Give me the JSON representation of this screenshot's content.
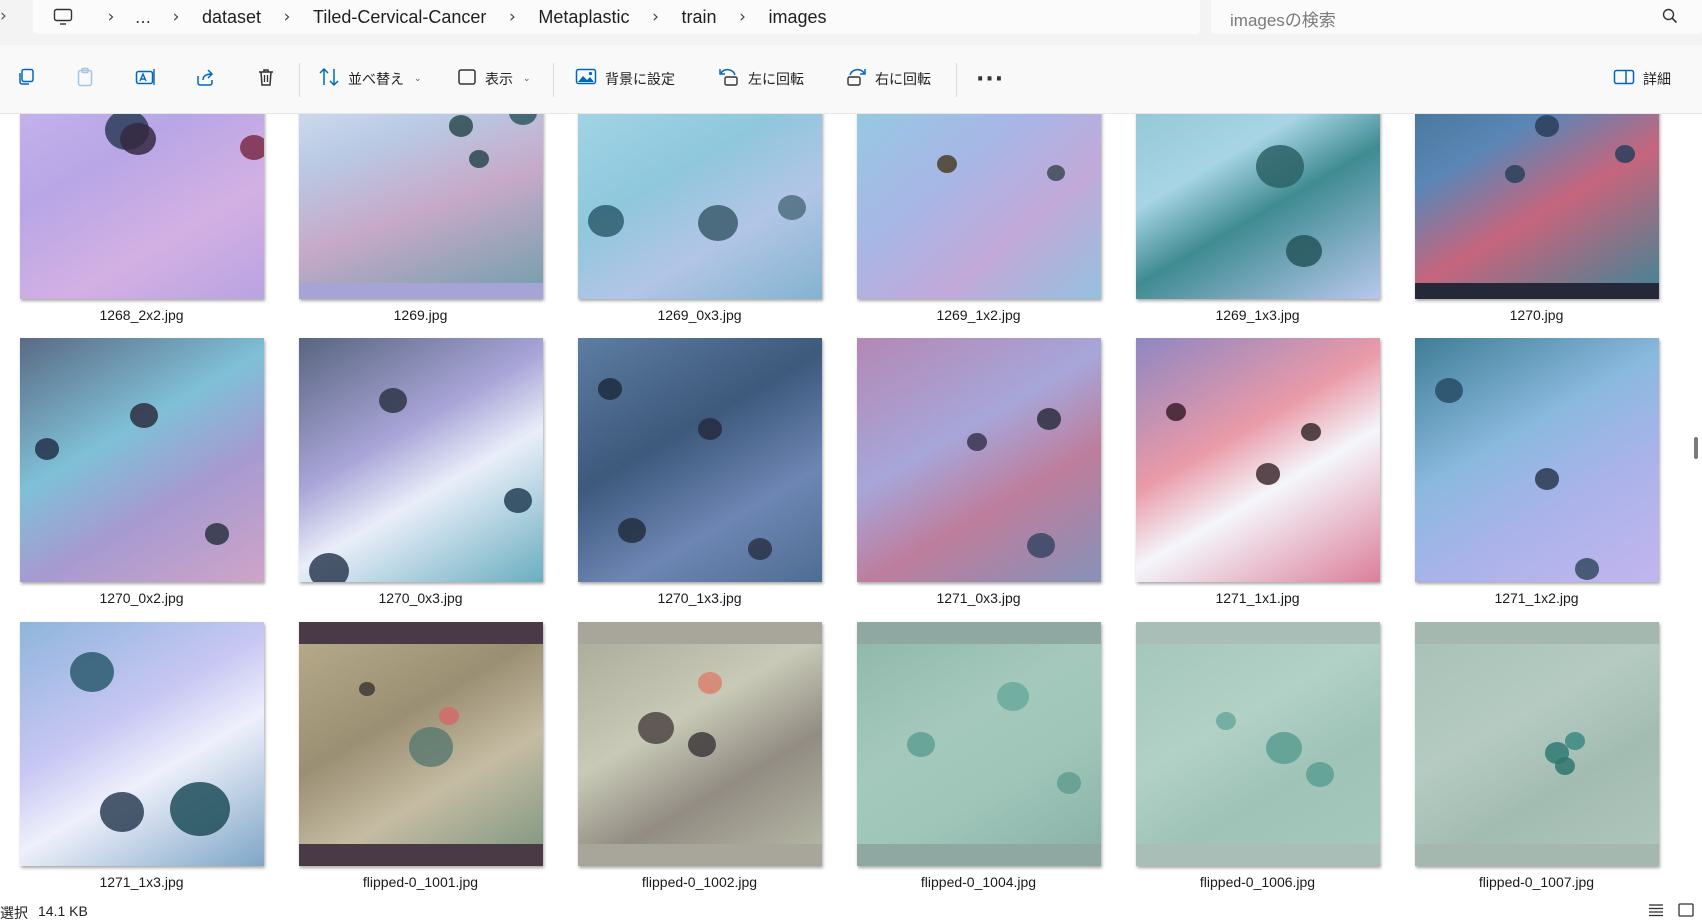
{
  "breadcrumb": {
    "more": "…",
    "items": [
      "dataset",
      "Tiled-Cervical-Cancer",
      "Metaplastic",
      "train",
      "images"
    ]
  },
  "search": {
    "placeholder": "imagesの検索"
  },
  "toolbar": {
    "sort_label": "並べ替え",
    "view_label": "表示",
    "set_background_label": "背景に設定",
    "rotate_left_label": "左に回転",
    "rotate_right_label": "右に回転",
    "more_label": "···",
    "details_label": "詳細"
  },
  "files": [
    {
      "name": "1268_2x2.jpg",
      "bg": "linear-gradient(150deg,#c9b8ee 0%,#b8a6e6 40%,#d3b0e3 70%,#b9a3e2 100%)"
    },
    {
      "name": "1269.jpg",
      "bg": "linear-gradient(160deg,#dfe9f6 0%,#b9c9e4 35%,#c7a9c9 60%,#6f9faa 100%)"
    },
    {
      "name": "1269_0x3.jpg",
      "bg": "linear-gradient(150deg,#a9dbe9 0%,#8fc7dc 45%,#b2c5e6 70%,#82b4cf 100%)"
    },
    {
      "name": "1269_1x2.jpg",
      "bg": "linear-gradient(140deg,#8fd0e0 0%,#a8b6e6 45%,#c2a9d9 70%,#94c1de 100%)"
    },
    {
      "name": "1269_1x3.jpg",
      "bg": "linear-gradient(150deg,#8bc0ce 0%,#a7d5e6 40%,#3f8b92 60%,#b8c8ec 100%)"
    },
    {
      "name": "1270.jpg",
      "bg": "linear-gradient(150deg,#3e6f8a 0%,#5a86b6 35%,#c6657d 60%,#3d8597 100%)"
    },
    {
      "name": "1270_0x2.jpg",
      "bg": "linear-gradient(150deg,#5a6a84 0%,#7fc0d7 40%,#a69ad1 65%,#cfa4c7 100%)"
    },
    {
      "name": "1270_0x3.jpg",
      "bg": "linear-gradient(150deg,#58657f 0%,#a9a5d8 40%,#e9eef9 60%,#6aaec0 100%)"
    },
    {
      "name": "1270_1x3.jpg",
      "bg": "linear-gradient(150deg,#5d7da2 0%,#3d597c 40%,#6d86b4 70%,#4f6d92 100%)"
    },
    {
      "name": "1271_0x3.jpg",
      "bg": "linear-gradient(150deg,#b388b5 0%,#a7a6d9 40%,#be7d9c 65%,#8692b9 100%)"
    },
    {
      "name": "1271_1x1.jpg",
      "bg": "linear-gradient(150deg,#8e87c2 0%,#ea9aa8 40%,#f4f6fb 60%,#dc7f9b 100%)"
    },
    {
      "name": "1271_1x2.jpg",
      "bg": "linear-gradient(150deg,#3f7d95 0%,#8ab9de 40%,#a9b3ea 65%,#c3b5ee 100%)"
    },
    {
      "name": "1271_1x3.jpg",
      "bg": "linear-gradient(150deg,#8eb5dc 0%,#c8c7f3 40%,#eef0fb 60%,#7ea6c6 100%)"
    },
    {
      "name": "flipped-0_1001.jpg",
      "bg": "linear-gradient(150deg,#b9ad8d 0%,#9b8f73 40%,#c5bca3 65%,#7a947e 100%)"
    },
    {
      "name": "flipped-0_1002.jpg",
      "bg": "linear-gradient(150deg,#a8a997 0%,#c8cab7 40%,#928c82 65%,#b9bcaa 100%)"
    },
    {
      "name": "flipped-0_1004.jpg",
      "bg": "linear-gradient(150deg,#8fb6aa 0%,#a4c8bc 40%,#9fc5b9 65%,#87b0a4 100%)"
    },
    {
      "name": "flipped-0_1006.jpg",
      "bg": "linear-gradient(150deg,#a3c5b9 0%,#b2d1c6 40%,#9fc3b7 65%,#a7c9bd 100%)"
    },
    {
      "name": "flipped-0_1007.jpg",
      "bg": "linear-gradient(150deg,#a7c0b6 0%,#b5cbc2 40%,#a3bcb2 65%,#afc6bc 100%)"
    }
  ],
  "status": {
    "selection_label": "選択",
    "size": "14.1 KB"
  },
  "icons": {
    "copy": "copy-icon",
    "paste": "paste-icon",
    "rename": "rename-icon",
    "share": "share-icon",
    "delete": "trash-icon",
    "sort": "sort-icon",
    "view": "view-icon",
    "background": "image-icon",
    "rotate_left": "rotate-left-icon",
    "rotate_right": "rotate-right-icon",
    "details": "details-pane-icon"
  },
  "colors": {
    "accent": "#0067c0",
    "toolbar_bg": "#f9f9f9",
    "titlebar_bg": "#f3f3f3"
  }
}
